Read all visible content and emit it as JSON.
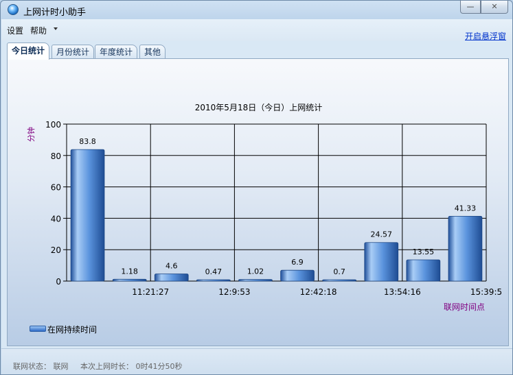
{
  "window": {
    "title": "上网计时小助手",
    "minimize_label": "—",
    "close_label": "✕"
  },
  "menu": {
    "settings": "设置",
    "help": "帮助",
    "float_window_link": "开启悬浮窗"
  },
  "tabs": [
    {
      "label": "今日统计",
      "active": true
    },
    {
      "label": "月份统计",
      "active": false
    },
    {
      "label": "年度统计",
      "active": false
    },
    {
      "label": "其他",
      "active": false
    }
  ],
  "chart_data": {
    "type": "bar",
    "title": "2010年5月18日（今日）上网统计",
    "ylabel": "分钟",
    "xlabel": "联网时间点",
    "ylim": [
      0,
      100
    ],
    "yticks": [
      0,
      20,
      40,
      60,
      80,
      100
    ],
    "grid": true,
    "legend_position": "bottom-left",
    "x_tick_labels": [
      "11:21:27",
      "12:9:53",
      "12:42:18",
      "13:54:16",
      "15:39:5"
    ],
    "series": [
      {
        "name": "在网持续时间",
        "color": "#4a86d8",
        "values": [
          83.8,
          1.18,
          4.6,
          0.47,
          1.02,
          6.9,
          0.7,
          24.57,
          13.55,
          41.33
        ],
        "labels": [
          "83.8",
          "1.18",
          "4.6",
          "0.47",
          "1.02",
          "6.9",
          "0.7",
          "24.57",
          "13.55",
          "41.33"
        ]
      }
    ]
  },
  "status": {
    "connection": "联网状态：  联网",
    "duration": "本次上网时长：  0时41分50秒"
  }
}
